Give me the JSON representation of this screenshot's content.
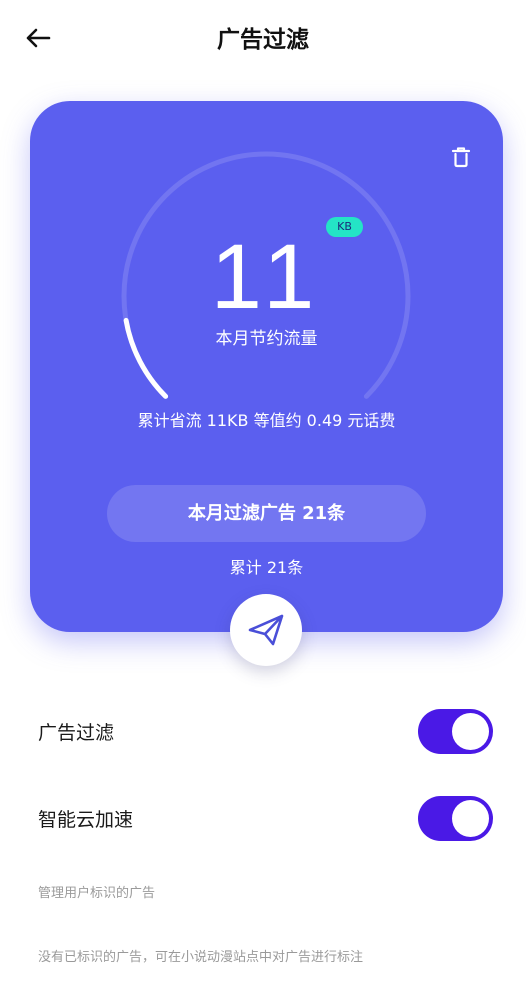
{
  "header": {
    "title": "广告过滤",
    "back_icon": "back-arrow-icon"
  },
  "card": {
    "background": "#5b5fef",
    "trash_icon": "trash-icon",
    "saved_amount": "11",
    "saved_unit": "KB",
    "saved_label": "本月节约流量",
    "gauge_progress": 0.13,
    "summary": "累计省流 11KB 等值约 0.49 元话费",
    "filter_count_label": "本月过滤广告 21条",
    "total_label": "累计 21条"
  },
  "send_icon": "paper-plane-icon",
  "settings": [
    {
      "label": "广告过滤",
      "enabled": true
    },
    {
      "label": "智能云加速",
      "enabled": true
    }
  ],
  "toggle_color": "#4a19e6",
  "section_note": "管理用户标识的广告",
  "empty_note": "没有已标识的广告，可在小说动漫站点中对广告进行标注"
}
